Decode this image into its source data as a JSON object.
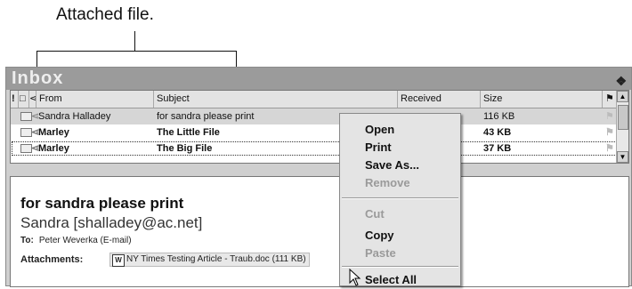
{
  "callout": {
    "text": "Attached file."
  },
  "inbox": {
    "title": "Inbox",
    "columns": [
      "",
      "",
      "",
      "From",
      "Subject",
      "Received",
      "Size",
      ""
    ],
    "rows": [
      {
        "from": "Sandra Halladey",
        "subject": "for sandra please print",
        "received": "",
        "size": "116 KB",
        "unread": false,
        "selected": true
      },
      {
        "from": "Marley",
        "subject": "The Little File",
        "received": "",
        "size": "43 KB",
        "unread": true,
        "selected": false
      },
      {
        "from": "Marley",
        "subject": "The Big File",
        "received": "",
        "size": "37 KB",
        "unread": true,
        "selected": false,
        "focused": true
      }
    ]
  },
  "preview": {
    "subject": "for sandra please print",
    "from": "Sandra [shalladey@ac.net]",
    "to_label": "To:",
    "to_value": "Peter Weverka (E-mail)",
    "attachments_label": "Attachments:",
    "attachment_name": "NY Times Testing Article - Traub.doc (111 KB)",
    "attachment_icon": "W"
  },
  "context_menu": {
    "items": [
      {
        "label": "Open",
        "enabled": true
      },
      {
        "label": "Print",
        "enabled": true
      },
      {
        "label": "Save As...",
        "enabled": true
      },
      {
        "label": "Remove",
        "enabled": false
      },
      {
        "label": "Cut",
        "enabled": false
      },
      {
        "label": "Copy",
        "enabled": true
      },
      {
        "label": "Paste",
        "enabled": false
      },
      {
        "label": "Select All",
        "enabled": true
      }
    ]
  },
  "icons": {
    "importance": "exclamation-icon",
    "doc": "document-icon",
    "attachment": "paperclip-icon",
    "flag": "flag-icon",
    "envelope": "envelope-icon",
    "word": "word-document-icon",
    "pointer": "mouse-pointer-icon"
  }
}
